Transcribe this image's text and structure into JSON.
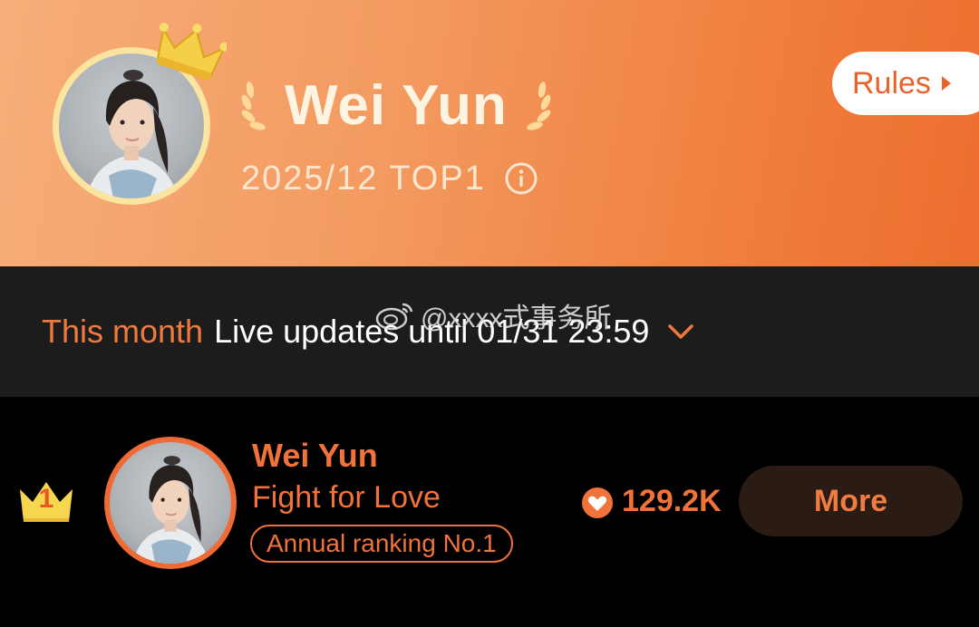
{
  "hero": {
    "name": "Wei Yun",
    "period": "2025/12 TOP1",
    "rules_label": "Rules"
  },
  "month_bar": {
    "month_label": "This month",
    "update_text": "Live updates until 01/31 23:59"
  },
  "watermark": {
    "text": "@xxxx式事务所"
  },
  "ranking": {
    "rows": [
      {
        "rank": "1",
        "name": "Wei Yun",
        "show": "Fight for Love",
        "tag": "Annual ranking No.1",
        "hearts": "129.2K",
        "more_label": "More"
      }
    ]
  },
  "colors": {
    "accent": "#f2733a",
    "hero_gradient_start": "#f6ae78",
    "hero_gradient_end": "#ed6d2f",
    "month_bar_bg": "#1c1c1c",
    "more_button_bg": "#2a1b14",
    "crown_gold": "#f5cf4a"
  },
  "icons": {
    "crown": "crown-icon",
    "laurel": "laurel-icon",
    "info": "info-icon",
    "rules_caret": "caret-right-icon",
    "month_chevron": "chevron-down-icon",
    "heart": "heart-icon",
    "rank_badge": "rank-crown-icon",
    "watermark_logo": "weibo-logo-icon"
  }
}
